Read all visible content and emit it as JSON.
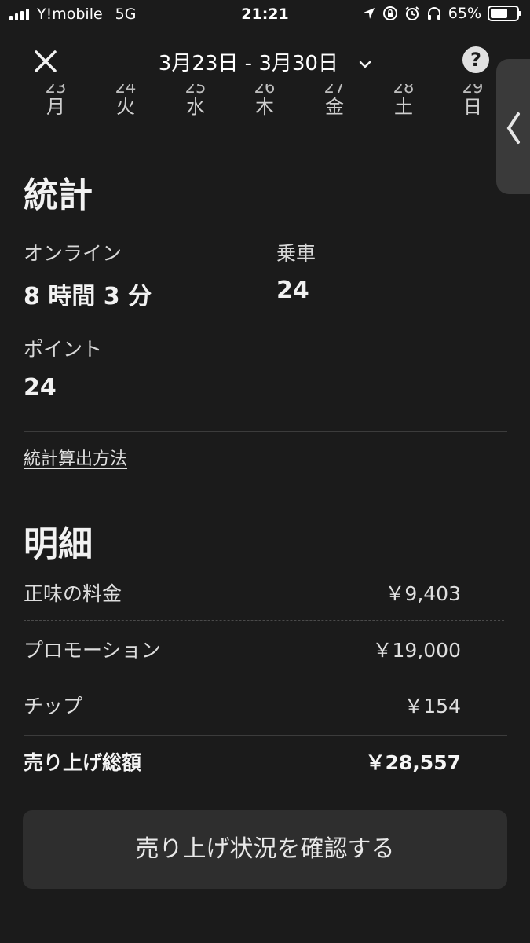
{
  "status_bar": {
    "carrier": "Y!mobile",
    "network": "5G",
    "time": "21:21",
    "battery_percent": "65%",
    "battery_level": 0.65,
    "icons": [
      "signal-icon",
      "location-arrow-icon",
      "rotation-lock-icon",
      "alarm-icon",
      "headphones-icon",
      "battery-icon"
    ]
  },
  "header": {
    "date_range": "3月23日 - 3月30日",
    "close_icon": "close-icon",
    "dropdown_icon": "chevron-down-icon",
    "help_label": "?"
  },
  "week": [
    {
      "num": "23",
      "weekday": "月"
    },
    {
      "num": "24",
      "weekday": "火"
    },
    {
      "num": "25",
      "weekday": "水"
    },
    {
      "num": "26",
      "weekday": "木"
    },
    {
      "num": "27",
      "weekday": "金"
    },
    {
      "num": "28",
      "weekday": "土"
    },
    {
      "num": "29",
      "weekday": "日"
    }
  ],
  "stats": {
    "title": "統計",
    "online_label": "オンライン",
    "online_value": "8 時間 3 分",
    "rides_label": "乗車",
    "rides_value": "24",
    "points_label": "ポイント",
    "points_value": "24",
    "method_link": "統計算出方法"
  },
  "breakdown": {
    "title": "明細",
    "rows": [
      {
        "label": "正味の料金",
        "amount": "￥9,403"
      },
      {
        "label": "プロモーション",
        "amount": "￥19,000"
      },
      {
        "label": "チップ",
        "amount": "￥154"
      }
    ],
    "total_label": "売り上げ総額",
    "total_amount": "￥28,557"
  },
  "cta_label": "売り上げ状況を確認する",
  "colors": {
    "background": "#1b1b1b",
    "button_bg": "#2e2e2e",
    "side_tab": "#3a3a3a"
  }
}
